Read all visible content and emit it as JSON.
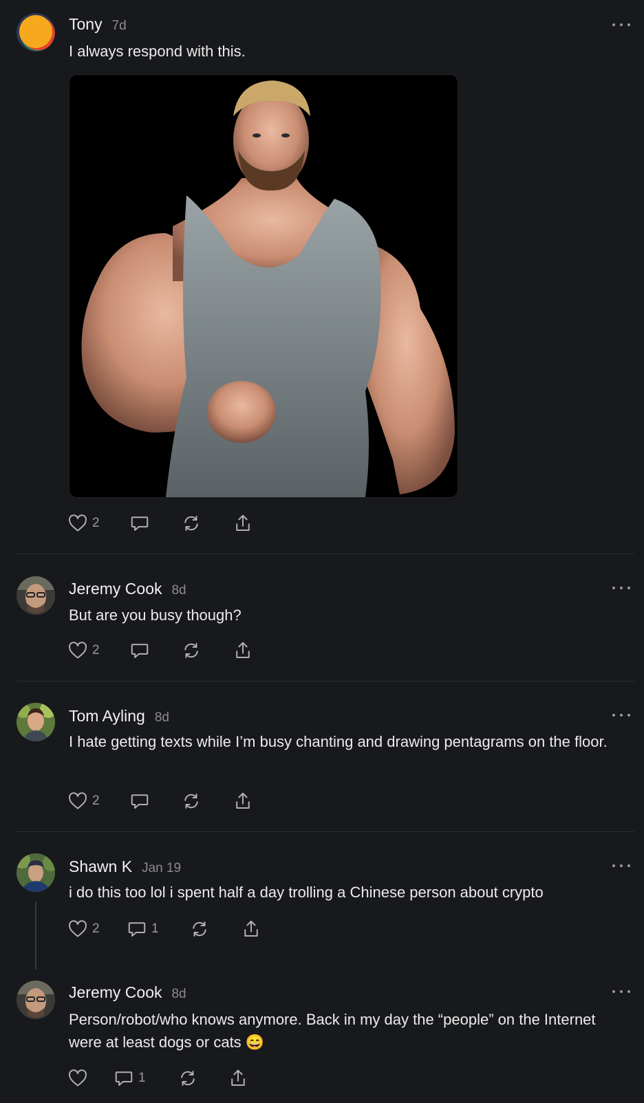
{
  "comments": [
    {
      "author": "Tony",
      "time": "7d",
      "text": "I always respond with this.",
      "image_alt": "AI-generated image of an extremely muscular bearded man in a grey tank top",
      "likes": "2",
      "replies": ""
    },
    {
      "author": "Jeremy Cook",
      "time": "8d",
      "text": "But are you busy though?",
      "likes": "2",
      "replies": ""
    },
    {
      "author": "Tom Ayling",
      "time": "8d",
      "text": "I hate getting texts while I’m busy chanting and drawing pentagrams on the floor.",
      "likes": "2",
      "replies": ""
    },
    {
      "author": "Shawn K",
      "time": "Jan 19",
      "text": "i do this too lol i spent half a day trolling a Chinese person about crypto",
      "likes": "2",
      "replies": "1"
    },
    {
      "author": "Jeremy Cook",
      "time": "8d",
      "text": "Person/robot/who knows anymore. Back in my day the “people” on the Internet were at least dogs or cats 😄",
      "likes": "",
      "replies": "1"
    }
  ],
  "icons": {
    "like": "heart-icon",
    "comment": "comment-bubble-icon",
    "restack": "restack-icon",
    "share": "share-icon",
    "more": "more-options-icon"
  },
  "colors": {
    "background": "#18191c",
    "text": "#ececec",
    "muted": "#8c8c90",
    "icon": "#b0b0b4",
    "divider": "#2d2e33"
  }
}
